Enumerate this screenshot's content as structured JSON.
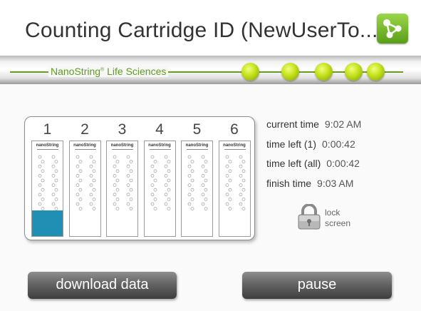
{
  "header": {
    "title": "Counting Cartridge ID (NewUserTo...",
    "network_icon": "network-icon"
  },
  "banner": {
    "brand": "NanoString",
    "brand_mark": "®",
    "brand_suffix": " Life Sciences",
    "indicator_count": 5,
    "indicator_color": "#c3df1a"
  },
  "cartridge": {
    "slots": [
      {
        "number": "1",
        "logo": "nanoString",
        "progress": 0.27
      },
      {
        "number": "2",
        "logo": "nanoString",
        "progress": 0
      },
      {
        "number": "3",
        "logo": "nanoString",
        "progress": 0
      },
      {
        "number": "4",
        "logo": "nanoString",
        "progress": 0
      },
      {
        "number": "5",
        "logo": "nanoString",
        "progress": 0
      },
      {
        "number": "6",
        "logo": "nanoString",
        "progress": 0
      }
    ],
    "progress_color": "#1f8fb3"
  },
  "status": {
    "current_time_label": "current time",
    "current_time": "9:02 AM",
    "time_left_1_label": "time left (1)",
    "time_left_1": "0:00:42",
    "time_left_all_label": "time left (all)",
    "time_left_all": "0:00:42",
    "finish_time_label": "finish time",
    "finish_time": "9:03 AM"
  },
  "lock": {
    "icon": "padlock-icon",
    "label_line1": "lock",
    "label_line2": "screen"
  },
  "actions": {
    "download_label": "download data",
    "pause_label": "pause"
  }
}
